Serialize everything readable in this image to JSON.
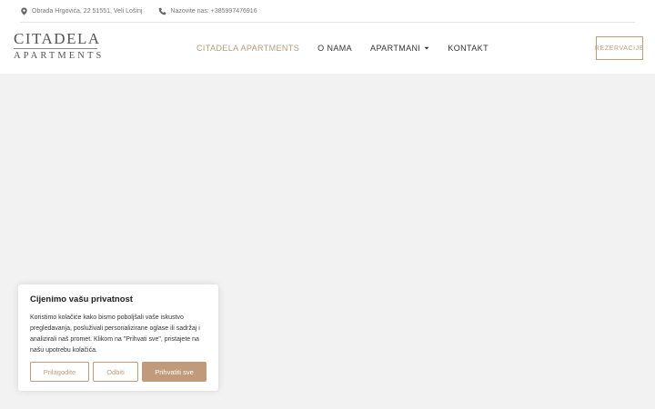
{
  "topbar": {
    "address": "Obrada Hrgovića, 22 51551, Veli Lošinj",
    "phone": "Nazovite nas: +385997476916",
    "icons": {
      "address": "map-pin-icon",
      "phone": "phone-icon"
    }
  },
  "header": {
    "logo_top": "CITADELA",
    "logo_bottom": "APARTMENTS",
    "nav": [
      {
        "label": "CITADELA APARTMENTS",
        "active": true
      },
      {
        "label": "O NAMA"
      },
      {
        "label": "APARTMANI",
        "has_dropdown": true
      },
      {
        "label": "KONTAKT"
      }
    ],
    "cta": "REZERVACIJE"
  },
  "cookie": {
    "title": "Cijenimo vašu privatnost",
    "text": "Koristimo kolačiće kako bismo poboljšali vaše iskustvo pregledavanja, posluživali personalizirane oglase ili sadržaj i analizirali naš promet. Klikom na \"Prihvati sve\", pristajete na našu upotrebu kolačića.",
    "buttons": {
      "customize": "Prilagodite",
      "reject": "Odbiti",
      "accept": "Prihvatiti sve"
    }
  },
  "colors": {
    "accent": "#c19a7b",
    "nav_active": "#b89b7a",
    "background": "#f2f2f2"
  }
}
